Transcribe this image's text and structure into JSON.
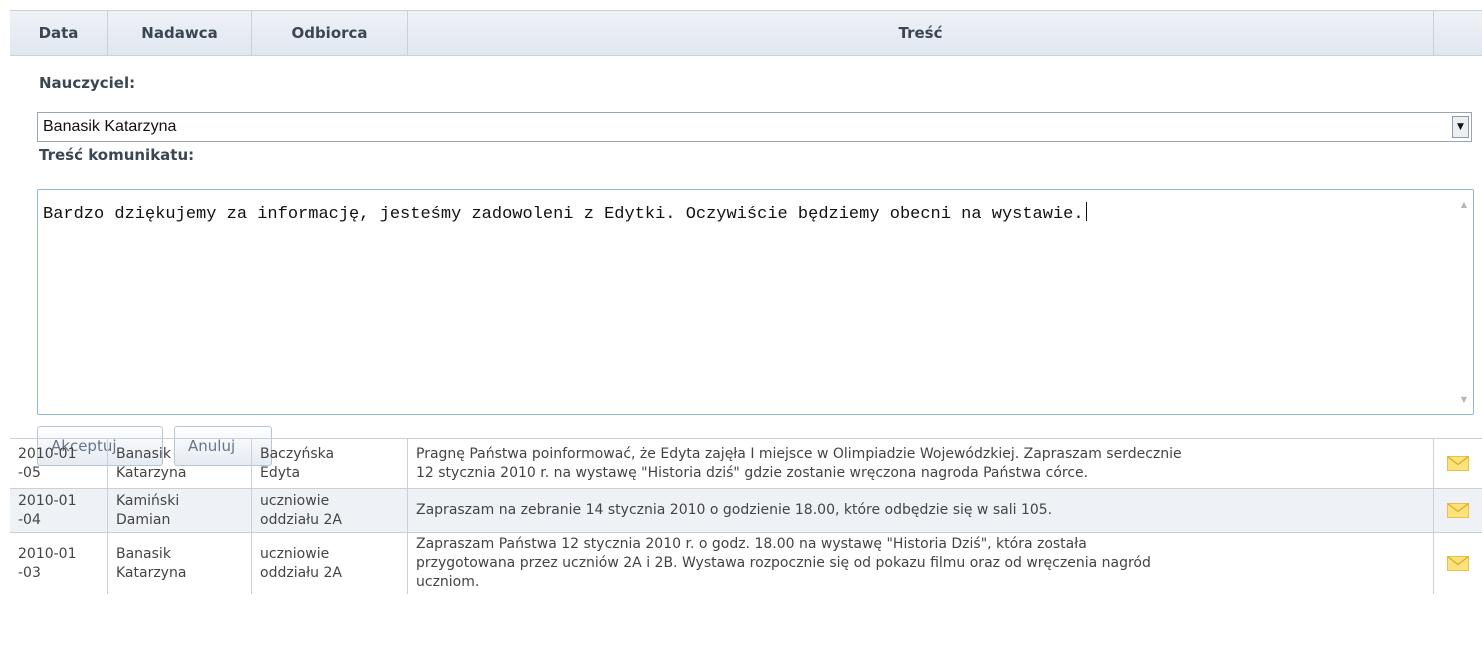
{
  "table": {
    "headers": {
      "date": "Data",
      "sender": "Nadawca",
      "recipient": "Odbiorca",
      "content": "Treść"
    }
  },
  "form": {
    "teacher_label": "Nauczyciel:",
    "teacher_selected": "Banasik Katarzyna",
    "message_label": "Treść komunikatu:",
    "message_text": "Bardzo dziękujemy za informację, jesteśmy zadowoleni z Edytki. Oczywiście będziemy obecni na wystawie.",
    "accept_label": "Akceptuj",
    "cancel_label": "Anuluj"
  },
  "messages": [
    {
      "date_line1": "2010-01",
      "date_line2": "-05",
      "sender_line1": "Banasik",
      "sender_line2": "Katarzyna",
      "recipient_line1": "Baczyńska",
      "recipient_line2": "Edyta",
      "content_line1": "Pragnę Państwa poinformować, że Edyta zajęła I miejsce w Olimpiadzie Wojewódzkiej. Zapraszam serdecznie",
      "content_line2": "12 stycznia 2010 r. na wystawę \"Historia dziś\" gdzie zostanie wręczona nagroda Państwa córce.",
      "content_line3": ""
    },
    {
      "date_line1": "2010-01",
      "date_line2": "-04",
      "sender_line1": "Kamiński",
      "sender_line2": "Damian",
      "recipient_line1": "uczniowie",
      "recipient_line2": "oddziału 2A",
      "content_line1": "Zapraszam na zebranie 14 stycznia 2010 o godzienie 18.00, które odbędzie się w sali 105.",
      "content_line2": "",
      "content_line3": ""
    },
    {
      "date_line1": "2010-01",
      "date_line2": "-03",
      "sender_line1": "Banasik",
      "sender_line2": "Katarzyna",
      "recipient_line1": "uczniowie",
      "recipient_line2": "oddziału 2A",
      "content_line1": "Zapraszam Państwa 12 stycznia 2010 r. o godz. 18.00 na wystawę \"Historia Dziś\", która została",
      "content_line2": "przygotowana przez uczniów 2A i 2B. Wystawa rozpocznie się od pokazu filmu oraz od wręczenia nagród",
      "content_line3": "uczniom."
    }
  ],
  "icons": {
    "envelope": "envelope-icon",
    "dropdown": "chevron-down-icon"
  },
  "colors": {
    "envelope": "#f4d35e",
    "header_bg": "#e6ebf2",
    "alt_row": "#eef1f5"
  }
}
